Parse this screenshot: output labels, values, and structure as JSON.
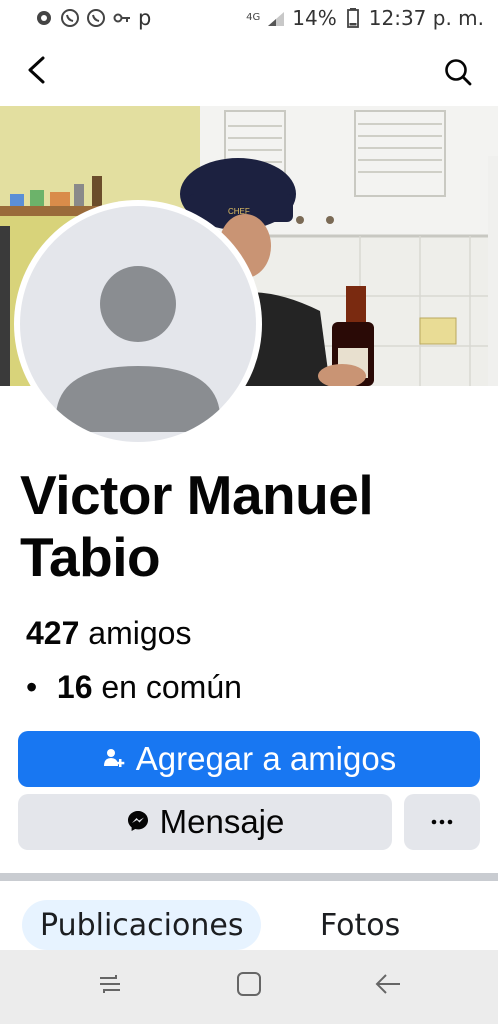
{
  "status_bar": {
    "network": "4G",
    "battery_text": "14%",
    "time_text": "12:37 p. m.",
    "notif_letter": "p"
  },
  "header": {
    "back_icon": "back-arrow-icon",
    "search_icon": "search-icon"
  },
  "profile": {
    "name": "Victor Manuel Tabio",
    "friends_count": "427",
    "friends_label": "amigos",
    "mutual_count": "16",
    "mutual_label": "en común",
    "bullet": "•"
  },
  "actions": {
    "add_friend_label": "Agregar a amigos",
    "message_label": "Mensaje",
    "more_label": "···"
  },
  "tabs": [
    {
      "label": "Publicaciones",
      "active": true
    },
    {
      "label": "Fotos",
      "active": false
    }
  ],
  "colors": {
    "primary": "#1877f2",
    "secondary_bg": "#e4e6eb",
    "active_tab_bg": "#e7f3ff"
  }
}
